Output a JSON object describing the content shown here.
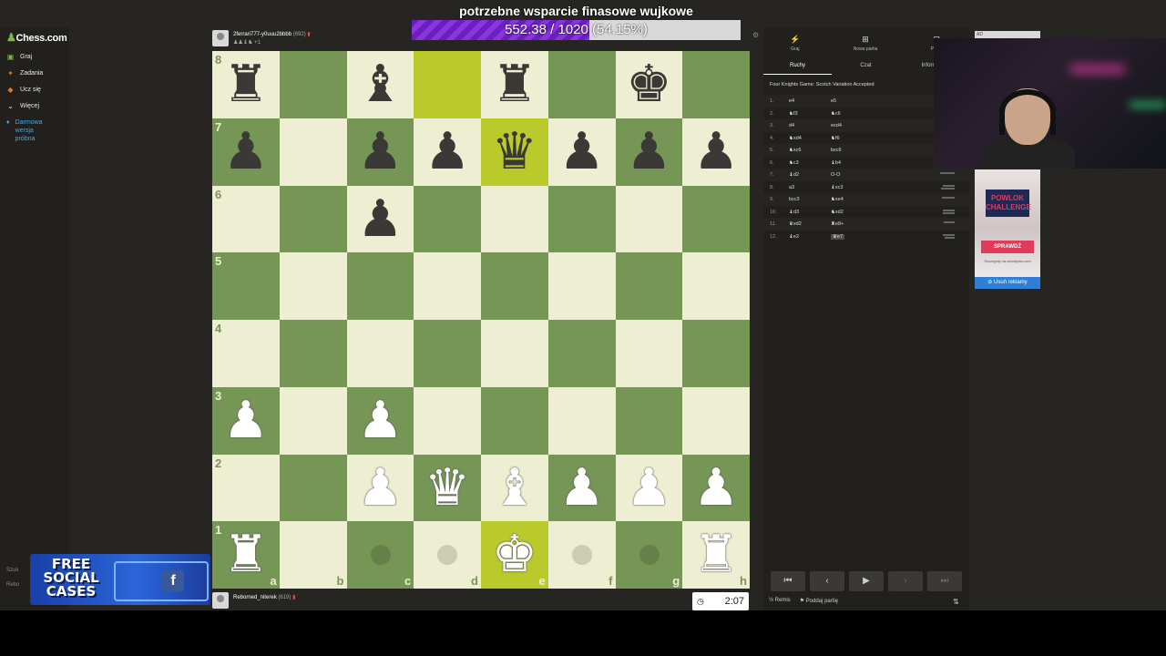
{
  "sidebar": {
    "logo": "Chess.com",
    "items": [
      {
        "label": "Graj",
        "icon": "play-icon"
      },
      {
        "label": "Zadania",
        "icon": "puzzle-icon"
      },
      {
        "label": "Ucz się",
        "icon": "learn-icon"
      },
      {
        "label": "Więcej",
        "icon": "chevron-down-icon"
      }
    ],
    "trial": "Darmowa wersja próbna",
    "bottom": [
      "Szuk",
      "Rebo"
    ]
  },
  "top_player": {
    "name": "2ferrari777-y0uuu2bbbb",
    "rating": "(692)",
    "captured": "♟♟♝♞ +1"
  },
  "bottom_player": {
    "name": "Reborned_niterek",
    "rating": "(619)",
    "clock": "2:07"
  },
  "board": {
    "ranks": [
      "8",
      "7",
      "6",
      "5",
      "4",
      "3",
      "2",
      "1"
    ],
    "files": [
      "a",
      "b",
      "c",
      "d",
      "e",
      "f",
      "g",
      "h"
    ],
    "position": [
      [
        "r",
        "",
        "b",
        "",
        "r",
        "",
        "k",
        ""
      ],
      [
        "p",
        "",
        "p",
        "p",
        "q",
        "p",
        "p",
        "p"
      ],
      [
        "",
        "",
        "p",
        "",
        "",
        "",
        "",
        ""
      ],
      [
        "",
        "",
        "",
        "",
        "",
        "",
        "",
        ""
      ],
      [
        "",
        "",
        "",
        "",
        "",
        "",
        "",
        ""
      ],
      [
        "P",
        "",
        "P",
        "",
        "",
        "",
        "",
        ""
      ],
      [
        "",
        "",
        "P",
        "Q",
        "B",
        "P",
        "P",
        "P"
      ],
      [
        "R",
        "",
        "",
        "",
        "K",
        "",
        "",
        "R"
      ]
    ],
    "highlighted": [
      "d8",
      "e7",
      "e1"
    ],
    "move_hints": [
      "c1",
      "d1",
      "f1",
      "g1"
    ]
  },
  "panel": {
    "tabs": [
      {
        "label": "Graj",
        "icon": "play-icon"
      },
      {
        "label": "Nowa partia",
        "icon": "plus-icon"
      },
      {
        "label": "Partie",
        "icon": "games-icon"
      }
    ],
    "subtabs": [
      "Ruchy",
      "Czat",
      "Informacje"
    ],
    "opening": "Four Knights Game: Scotch Variation Accepted",
    "moves": [
      {
        "n": "1.",
        "w": "e4",
        "b": "e5"
      },
      {
        "n": "2.",
        "w": "♞f3",
        "b": "♞c6"
      },
      {
        "n": "3.",
        "w": "d4",
        "b": "exd4"
      },
      {
        "n": "4.",
        "w": "♞xd4",
        "b": "♞f6"
      },
      {
        "n": "5.",
        "w": "♞xc6",
        "b": "bxc6"
      },
      {
        "n": "6.",
        "w": "♞c3",
        "b": "♝b4"
      },
      {
        "n": "7.",
        "w": "♝d2",
        "b": "O-O"
      },
      {
        "n": "8.",
        "w": "a3",
        "b": "♝xc3"
      },
      {
        "n": "9.",
        "w": "bxc3",
        "b": "♞xe4"
      },
      {
        "n": "10.",
        "w": "♝d3",
        "b": "♞xd2"
      },
      {
        "n": "11.",
        "w": "♛xd2",
        "b": "♜e8+"
      },
      {
        "n": "12.",
        "w": "♝e2",
        "b": "♛e7"
      }
    ],
    "nav": [
      "⏮",
      "‹",
      "▶",
      "›",
      "⏭"
    ],
    "footer": {
      "draw": "Remis",
      "resign": "Poddaj partię"
    }
  },
  "ad": {
    "label": "AD",
    "title": "POWLOK CHALLENGE",
    "button": "SPRAWDŹ",
    "small": "Szczegóły na cinestplus.com",
    "remove": "Usuń reklamy"
  },
  "overlay": {
    "title": "potrzebne wsparcie finasowe wujkowe",
    "goal_text": "552.38 / 1020 (54.15%)",
    "goal_fraction": 0.5415,
    "promo": "FREE SOCIAL CASES"
  }
}
